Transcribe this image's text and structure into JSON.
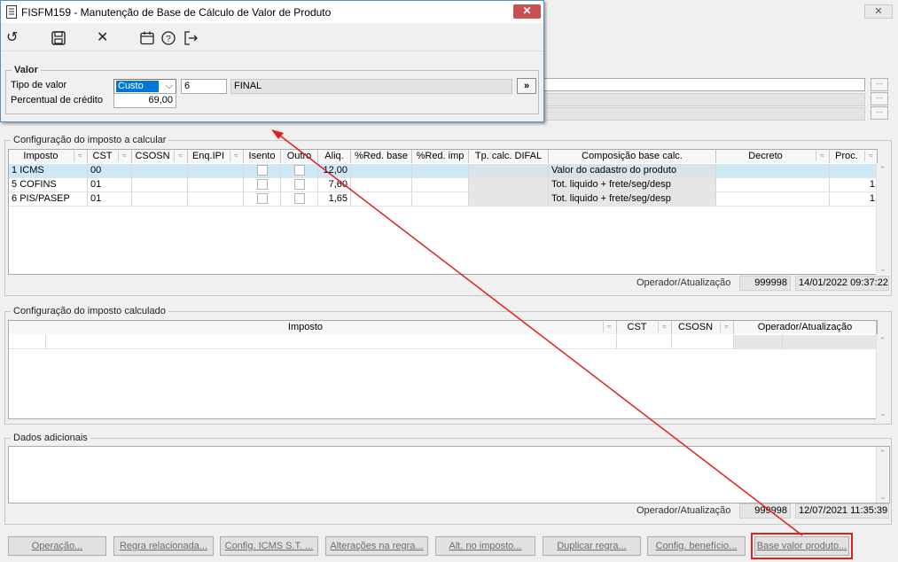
{
  "dialog": {
    "title": "FISFM159 - Manutenção de Base de Cálculo de Valor de Produto",
    "close_label": "✕",
    "toolbar": [
      "undo-icon",
      "save-icon",
      "close-icon",
      "calendar-icon",
      "help-icon",
      "exit-icon"
    ],
    "group_title": "Valor",
    "tipo_valor_label": "Tipo de valor",
    "tipo_valor_selected": "Custo",
    "tipo_valor_code": "6",
    "tipo_valor_desc": "FINAL",
    "more_label": "»",
    "percentual_label": "Percentual de crédito",
    "percentual_value": "69,00"
  },
  "main": {
    "close_label": "✕",
    "calcular": {
      "title": "Configuração do imposto a calcular",
      "headers": [
        "Imposto",
        "CST",
        "CSOSN",
        "Enq.IPI",
        "Isento",
        "Outro",
        "Aliq.",
        "%Red. base",
        "%Red. imp",
        "Tp. calc. DIFAL",
        "Composição base calc.",
        "Decreto",
        "Proc."
      ],
      "rows": [
        {
          "num": "1",
          "imposto": "ICMS",
          "cst": "00",
          "aliq": "12,00",
          "composicao": "Valor do cadastro do produto",
          "proc": ""
        },
        {
          "num": "5",
          "imposto": "COFINS",
          "cst": "01",
          "aliq": "7,60",
          "composicao": "Tot. liquido + frete/seg/desp",
          "proc": "1"
        },
        {
          "num": "6",
          "imposto": "PIS/PASEP",
          "cst": "01",
          "aliq": "1,65",
          "composicao": "Tot. liquido + frete/seg/desp",
          "proc": "1"
        }
      ],
      "operador_label": "Operador/Atualização",
      "operador": "999998",
      "atualizacao": "14/01/2022 09:37:22"
    },
    "calculado": {
      "title": "Configuração do imposto calculado",
      "headers": [
        "Imposto",
        "CST",
        "CSOSN",
        "Operador/Atualização"
      ]
    },
    "dados": {
      "title": "Dados adicionais",
      "operador_label": "Operador/Atualização",
      "operador": "999998",
      "atualizacao": "12/07/2021 11:35:39"
    },
    "buttons": [
      "Operação...",
      "Regra relacionada...",
      "Config. ICMS S.T. ...",
      "Alterações na regra...",
      "Alt. no imposto...",
      "Duplicar regra...",
      "Config. benefício...",
      "Base valor produto..."
    ]
  },
  "colors": {
    "accent": "#0078d7",
    "selection": "#cfe8f5",
    "annotation": "#e02020",
    "close": "#c75050"
  }
}
